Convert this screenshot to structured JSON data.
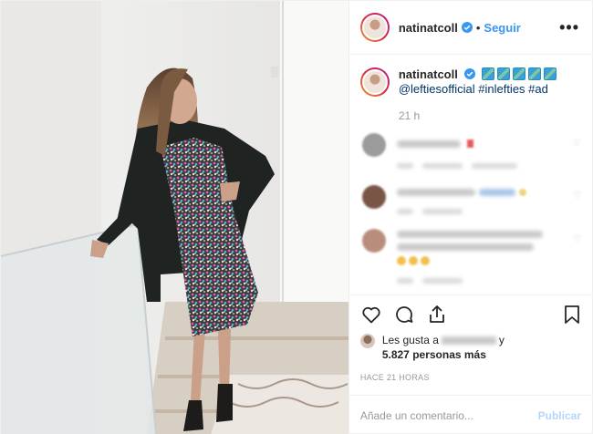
{
  "header": {
    "username": "natinatcoll",
    "dot": "•",
    "follow_label": "Seguir",
    "more_label": "•••"
  },
  "caption": {
    "username": "natinatcoll",
    "mention": "@leftiesofficial",
    "hashtags": "#inlefties #ad",
    "time": "21 h"
  },
  "likes": {
    "prefix": "Les gusta a",
    "suffix": "y",
    "count": "5.827 personas más"
  },
  "posted_ago": "HACE 21 HORAS",
  "comment_box": {
    "placeholder": "Añade un comentario...",
    "publish_label": "Publicar"
  },
  "colors": {
    "accent": "#3897f0",
    "publish_disabled": "#b3d7fb",
    "secondary_text": "#999999",
    "verified": "#3897f0"
  },
  "icons": [
    "verified-icon",
    "more-options-icon",
    "heart-icon",
    "comment-icon",
    "share-icon",
    "bookmark-icon"
  ]
}
